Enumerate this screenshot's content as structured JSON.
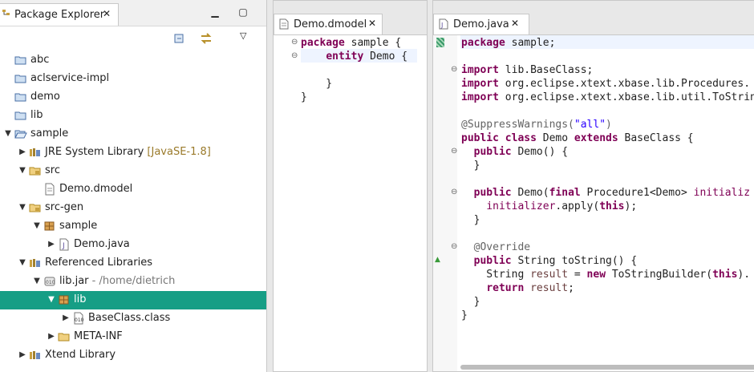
{
  "package_explorer": {
    "tab_label": "Package Explorer",
    "tree": [
      {
        "label": "abc",
        "level": 0,
        "twisty": "",
        "icon": "project-icon"
      },
      {
        "label": "aclservice-impl",
        "level": 0,
        "twisty": "",
        "icon": "project-icon"
      },
      {
        "label": "demo",
        "level": 0,
        "twisty": "",
        "icon": "project-icon"
      },
      {
        "label": "lib",
        "level": 0,
        "twisty": "",
        "icon": "project-icon"
      },
      {
        "label": "sample",
        "level": 0,
        "twisty": "open",
        "icon": "project-open-icon"
      },
      {
        "label": "JRE System Library",
        "deco": "[JavaSE-1.8]",
        "level": 1,
        "twisty": "closed",
        "icon": "library-icon"
      },
      {
        "label": "src",
        "level": 1,
        "twisty": "open",
        "icon": "source-folder-icon"
      },
      {
        "label": "Demo.dmodel",
        "level": 2,
        "twisty": "",
        "icon": "file-icon"
      },
      {
        "label": "src-gen",
        "level": 1,
        "twisty": "open",
        "icon": "source-folder-icon"
      },
      {
        "label": "sample",
        "level": 2,
        "twisty": "open",
        "icon": "package-icon"
      },
      {
        "label": "Demo.java",
        "level": 3,
        "twisty": "closed",
        "icon": "java-file-icon"
      },
      {
        "label": "Referenced Libraries",
        "level": 1,
        "twisty": "open",
        "icon": "library-icon"
      },
      {
        "label": "lib.jar",
        "deco": "- /home/dietrich",
        "level": 2,
        "twisty": "open",
        "icon": "jar-icon"
      },
      {
        "label": "lib",
        "level": 3,
        "twisty": "open",
        "icon": "package-icon",
        "selected": true
      },
      {
        "label": "BaseClass.class",
        "level": 4,
        "twisty": "closed",
        "icon": "class-file-icon"
      },
      {
        "label": "META-INF",
        "level": 3,
        "twisty": "closed",
        "icon": "folder-icon"
      },
      {
        "label": "Xtend Library",
        "level": 1,
        "twisty": "closed",
        "icon": "library-icon"
      }
    ]
  },
  "editor_dmodel": {
    "tab_label": "Demo.dmodel",
    "lines": [
      [
        {
          "t": "package",
          "c": "kw"
        },
        {
          "t": " sample {",
          "c": ""
        }
      ],
      [
        {
          "t": "    ",
          "c": ""
        },
        {
          "t": "entity",
          "c": "kw"
        },
        {
          "t": " Demo {",
          "c": ""
        }
      ],
      [
        {
          "t": "",
          "c": ""
        }
      ],
      [
        {
          "t": "    }",
          "c": ""
        }
      ],
      [
        {
          "t": "}",
          "c": ""
        }
      ]
    ]
  },
  "editor_java": {
    "tab_label": "Demo.java",
    "lines": [
      [
        {
          "t": "package",
          "c": "kw"
        },
        {
          "t": " sample;",
          "c": ""
        }
      ],
      [
        {
          "t": "",
          "c": ""
        }
      ],
      [
        {
          "t": "import",
          "c": "kw"
        },
        {
          "t": " lib.BaseClass;",
          "c": ""
        }
      ],
      [
        {
          "t": "import",
          "c": "kw"
        },
        {
          "t": " org.eclipse.xtext.xbase.lib.Procedures.",
          "c": ""
        }
      ],
      [
        {
          "t": "import",
          "c": "kw"
        },
        {
          "t": " org.eclipse.xtext.xbase.lib.util.ToStrin",
          "c": ""
        }
      ],
      [
        {
          "t": "",
          "c": ""
        }
      ],
      [
        {
          "t": "@SuppressWarnings(",
          "c": "ann"
        },
        {
          "t": "\"all\"",
          "c": "str"
        },
        {
          "t": ")",
          "c": "ann"
        }
      ],
      [
        {
          "t": "public",
          "c": "kw"
        },
        {
          "t": " ",
          "c": ""
        },
        {
          "t": "class",
          "c": "kw"
        },
        {
          "t": " Demo ",
          "c": ""
        },
        {
          "t": "extends",
          "c": "kw"
        },
        {
          "t": " BaseClass {",
          "c": ""
        }
      ],
      [
        {
          "t": "  ",
          "c": ""
        },
        {
          "t": "public",
          "c": "kw"
        },
        {
          "t": " Demo() {",
          "c": ""
        }
      ],
      [
        {
          "t": "  }",
          "c": ""
        }
      ],
      [
        {
          "t": "",
          "c": ""
        }
      ],
      [
        {
          "t": "  ",
          "c": ""
        },
        {
          "t": "public",
          "c": "kw"
        },
        {
          "t": " Demo(",
          "c": ""
        },
        {
          "t": "final",
          "c": "kw"
        },
        {
          "t": " Procedure1<Demo> ",
          "c": ""
        },
        {
          "t": "initializ",
          "c": "fld"
        }
      ],
      [
        {
          "t": "    ",
          "c": ""
        },
        {
          "t": "initializer",
          "c": "fld"
        },
        {
          "t": ".apply(",
          "c": ""
        },
        {
          "t": "this",
          "c": "kw"
        },
        {
          "t": ");",
          "c": ""
        }
      ],
      [
        {
          "t": "  }",
          "c": ""
        }
      ],
      [
        {
          "t": "",
          "c": ""
        }
      ],
      [
        {
          "t": "  ",
          "c": ""
        },
        {
          "t": "@Override",
          "c": "ann"
        }
      ],
      [
        {
          "t": "  ",
          "c": ""
        },
        {
          "t": "public",
          "c": "kw"
        },
        {
          "t": " String toString() {",
          "c": ""
        }
      ],
      [
        {
          "t": "    String ",
          "c": ""
        },
        {
          "t": "result",
          "c": "var"
        },
        {
          "t": " = ",
          "c": ""
        },
        {
          "t": "new",
          "c": "kw"
        },
        {
          "t": " ToStringBuilder(",
          "c": ""
        },
        {
          "t": "this",
          "c": "kw"
        },
        {
          "t": ").",
          "c": ""
        }
      ],
      [
        {
          "t": "    ",
          "c": ""
        },
        {
          "t": "return",
          "c": "kw"
        },
        {
          "t": " ",
          "c": ""
        },
        {
          "t": "result",
          "c": "var"
        },
        {
          "t": ";",
          "c": ""
        }
      ],
      [
        {
          "t": "  }",
          "c": ""
        }
      ],
      [
        {
          "t": "}",
          "c": ""
        }
      ]
    ]
  },
  "colors": {
    "selection": "#169e85",
    "keyword": "#7f0055",
    "string": "#2a00ff"
  }
}
